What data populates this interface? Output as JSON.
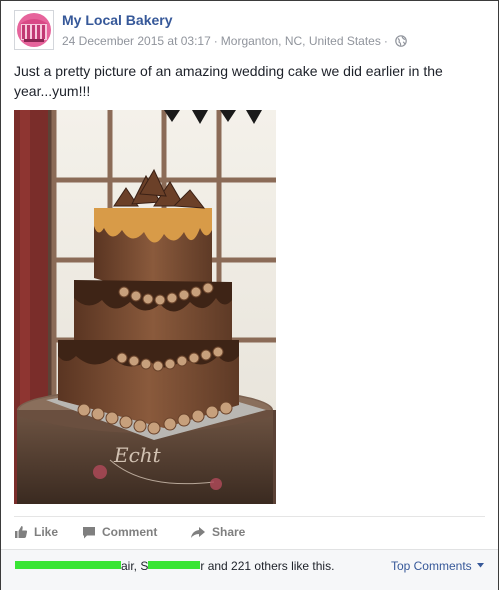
{
  "post": {
    "page_name": "My Local Bakery",
    "date": "24 December 2015 at 03:17",
    "separator": "·",
    "location": "Morganton, NC, United States",
    "visibility_icon": "globe-icon",
    "text": "Just a pretty picture of an amazing wedding cake we did earlier in the year...yum!!!"
  },
  "photo": {
    "watermark": "Echt"
  },
  "actions": {
    "like_label": "Like",
    "comment_label": "Comment",
    "share_label": "Share"
  },
  "likes": {
    "name1_visible": "air, S",
    "name2_visible": "r and 221 others like this.",
    "top_comments_label": "Top Comments"
  },
  "colors": {
    "link_blue": "#365899",
    "meta_grey": "#90949c",
    "redaction_green": "#39e535"
  }
}
